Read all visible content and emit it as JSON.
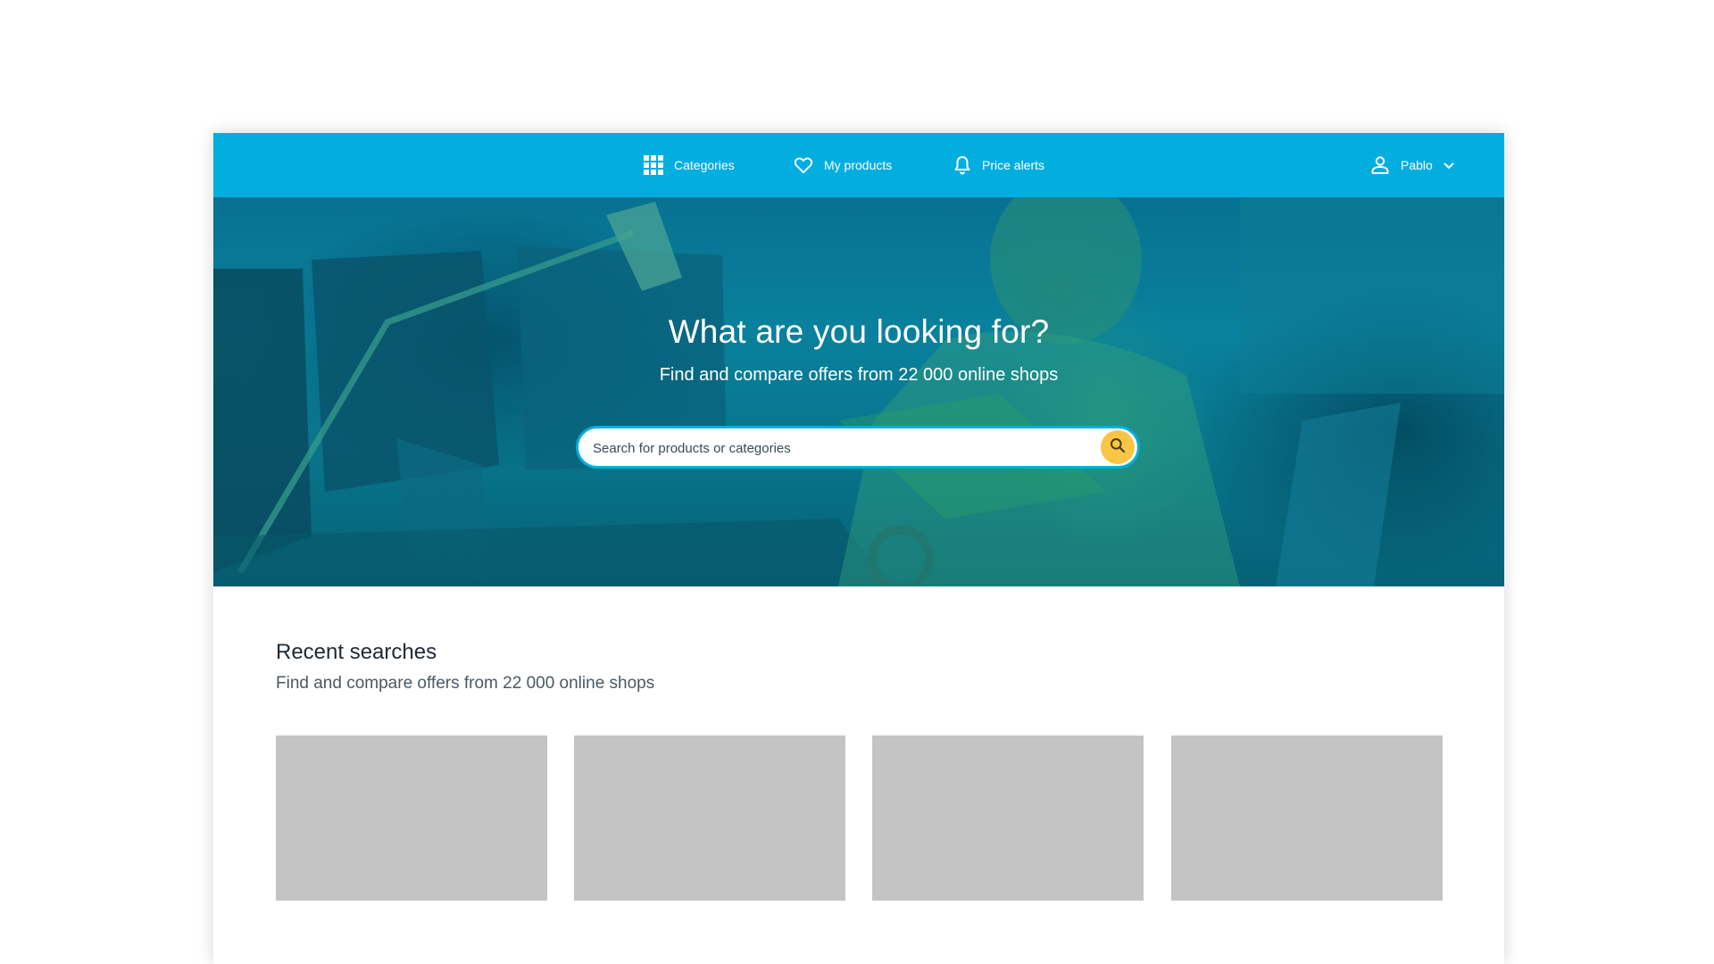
{
  "colors": {
    "brand": "#02aee0",
    "search_button": "#f8c545",
    "placeholder_card": "#c4c4c4"
  },
  "nav": {
    "categories": {
      "label": "Categories",
      "icon": "grid-icon"
    },
    "my_products": {
      "label": "My products",
      "icon": "heart-icon"
    },
    "price_alerts": {
      "label": "Price alerts",
      "icon": "bell-icon"
    },
    "user": {
      "name": "Pablo",
      "icon": "user-icon",
      "dropdown_icon": "chevron-down-icon"
    }
  },
  "hero": {
    "title": "What are you looking for?",
    "subtitle": "Find and compare offers from 22 000 online shops",
    "search": {
      "placeholder": "Search for products or categories",
      "value": "",
      "button_icon": "search-icon"
    }
  },
  "recent": {
    "title": "Recent searches",
    "subtitle": "Find and compare offers from 22 000 online shops",
    "cards": [
      "",
      "",
      "",
      ""
    ]
  }
}
